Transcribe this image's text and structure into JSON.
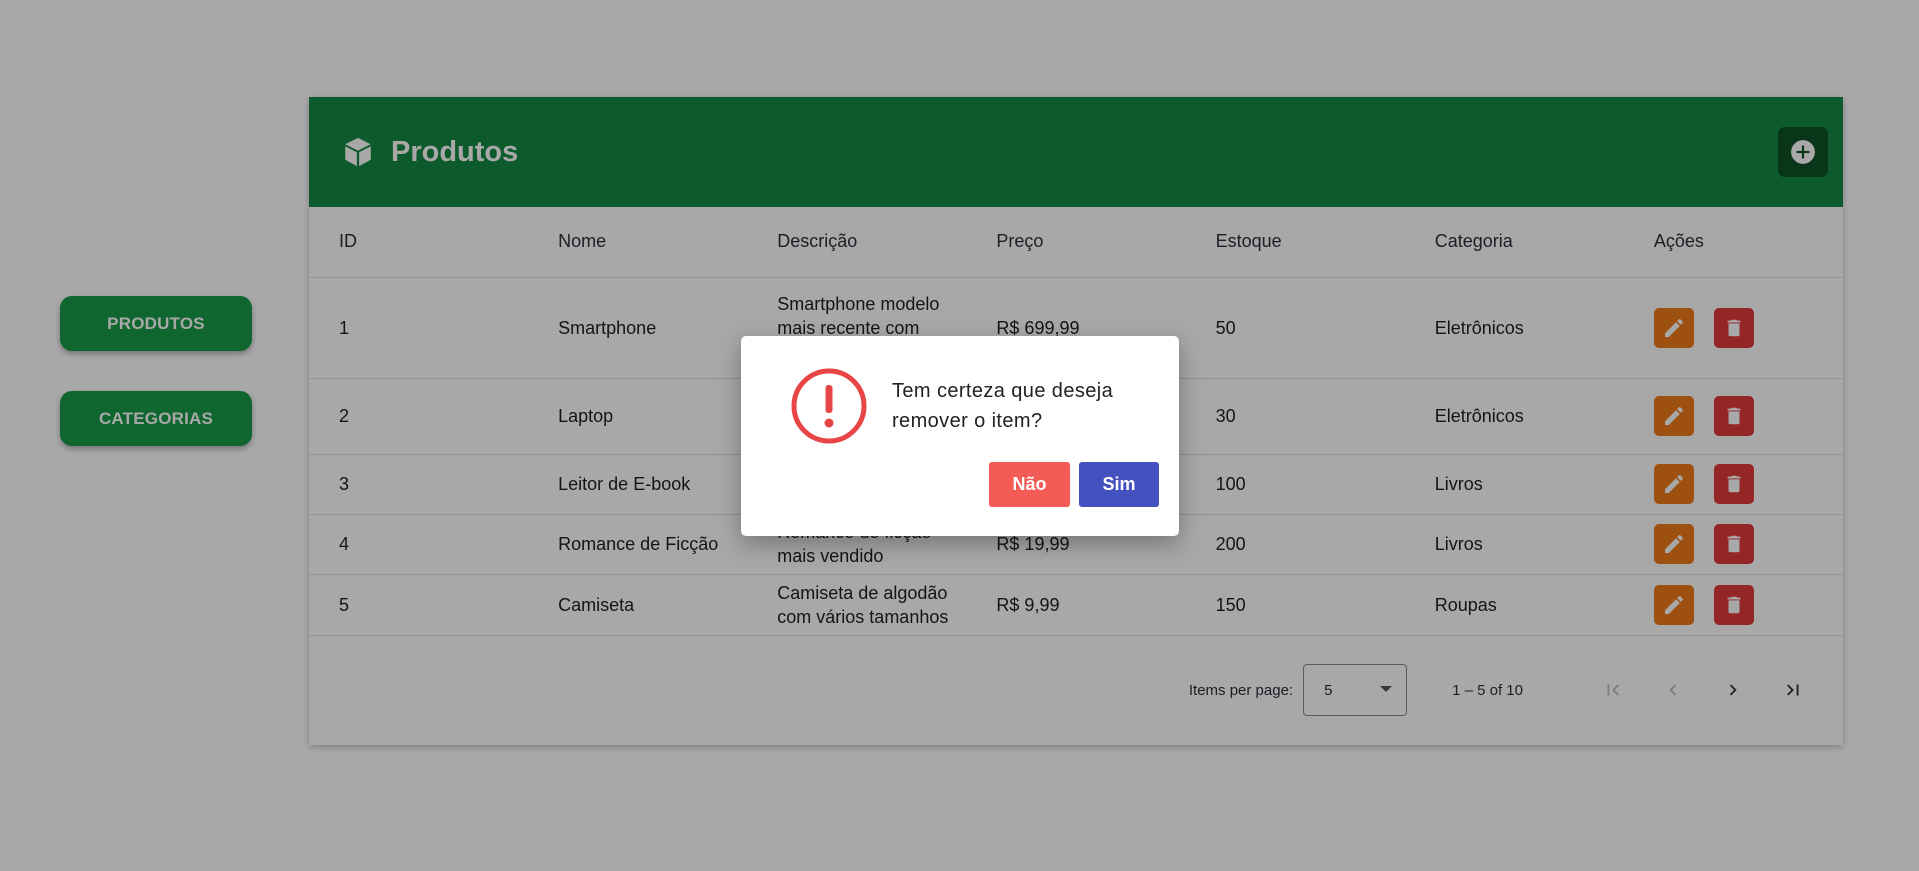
{
  "nav": {
    "products_label": "PRODUTOS",
    "categories_label": "CATEGORIAS"
  },
  "colors": {
    "primary_green": "#158a43",
    "nav_green": "#179c48",
    "edit": "#f07a1a",
    "delete": "#e23a3a",
    "confirm_no": "#f25c54",
    "confirm_yes": "#4452c0"
  },
  "header": {
    "title": "Produtos",
    "icon": "box-icon",
    "add_icon": "plus-circle-icon"
  },
  "table": {
    "columns": [
      "ID",
      "Nome",
      "Descrição",
      "Preço",
      "Estoque",
      "Categoria",
      "Ações"
    ],
    "rows": [
      {
        "id": "1",
        "name": "Smartphone",
        "description": "Smartphone modelo mais recente com 128GB de",
        "price": "R$ 699,99",
        "stock": "50",
        "category": "Eletrônicos"
      },
      {
        "id": "2",
        "name": "Laptop",
        "description": "",
        "price": "",
        "stock": "30",
        "category": "Eletrônicos"
      },
      {
        "id": "3",
        "name": "Leitor de E-book",
        "description": "",
        "price": "",
        "stock": "100",
        "category": "Livros"
      },
      {
        "id": "4",
        "name": "Romance de Ficção",
        "description": "Romance de ficção mais vendido",
        "price": "R$ 19,99",
        "stock": "200",
        "category": "Livros"
      },
      {
        "id": "5",
        "name": "Camiseta",
        "description": "Camiseta de algodão com vários tamanhos",
        "price": "R$ 9,99",
        "stock": "150",
        "category": "Roupas"
      }
    ]
  },
  "paginator": {
    "items_per_page_label": "Items per page:",
    "page_size": "5",
    "range_label": "1 – 5 of 10"
  },
  "dialog": {
    "icon": "warning-icon",
    "message": "Tem certeza que deseja remover o item?",
    "no_label": "Não",
    "yes_label": "Sim"
  }
}
